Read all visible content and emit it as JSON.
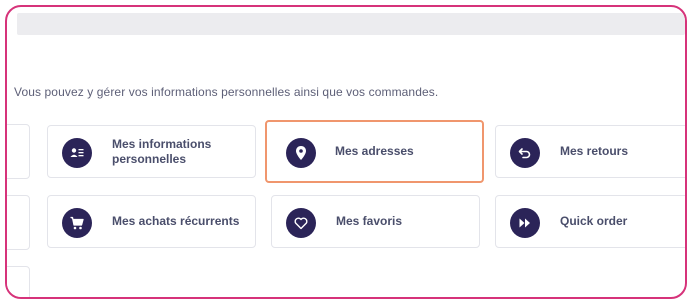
{
  "intro_text": "Vous pouvez y gérer vos informations personnelles ainsi que vos commandes.",
  "colors": {
    "frame": "#d6337a",
    "icon_bg": "#2b2458",
    "active_border": "#f0966d"
  },
  "cards": {
    "infos": {
      "label_line1": "Mes informations",
      "label_line2": "personnelles",
      "icon": "id-card-icon"
    },
    "adresses": {
      "label": "Mes adresses",
      "icon": "map-pin-icon",
      "selected": true
    },
    "retours": {
      "label": "Mes retours",
      "icon": "return-arrow-icon"
    },
    "achats": {
      "label": "Mes achats récurrents",
      "icon": "shopping-cart-icon"
    },
    "favoris": {
      "label": "Mes favoris",
      "icon": "heart-icon"
    },
    "quick": {
      "label": "Quick order",
      "icon": "fast-forward-icon"
    }
  }
}
